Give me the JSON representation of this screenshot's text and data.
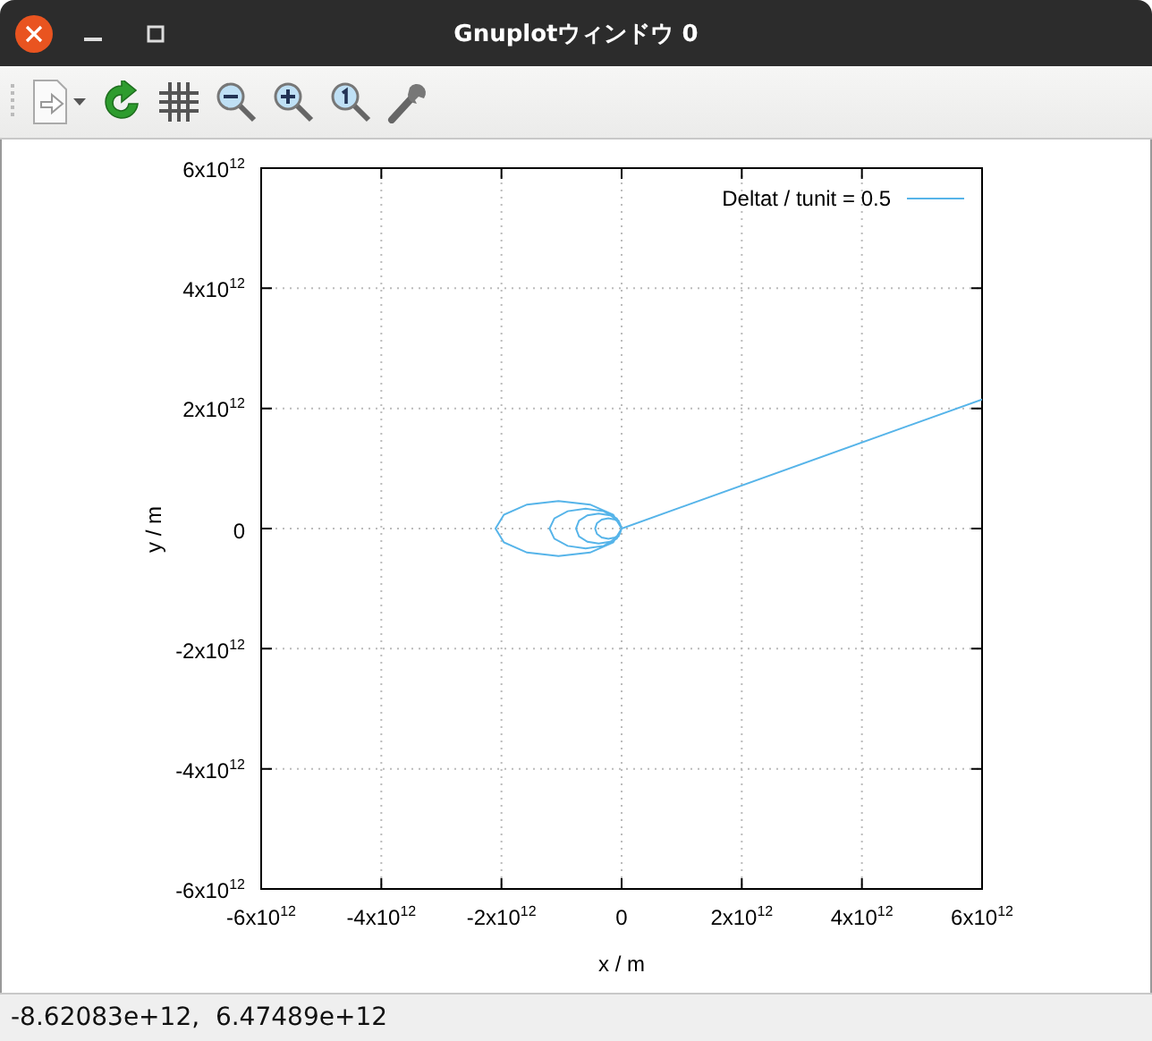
{
  "window": {
    "title": "Gnuplotウィンドウ 0"
  },
  "plot": {
    "chart_data": {
      "type": "line",
      "grid": true,
      "xlabel": "x / m",
      "ylabel": "y / m",
      "xlim": [
        -6000000000000.0,
        6000000000000.0
      ],
      "ylim": [
        -6000000000000.0,
        6000000000000.0
      ],
      "xticks": [
        {
          "value": -6000000000000.0,
          "label": "-6x10$^{12}$"
        },
        {
          "value": -4000000000000.0,
          "label": "-4x10$^{12}$"
        },
        {
          "value": -2000000000000.0,
          "label": "-2x10$^{12}$"
        },
        {
          "value": 0,
          "label": "0"
        },
        {
          "value": 2000000000000.0,
          "label": "2x10$^{12}$"
        },
        {
          "value": 4000000000000.0,
          "label": "4x10$^{12}$"
        },
        {
          "value": 6000000000000.0,
          "label": "6x10$^{12}$"
        }
      ],
      "yticks": [
        {
          "value": 6000000000000.0,
          "label": "6x10$^{12}$"
        },
        {
          "value": 4000000000000.0,
          "label": "4x10$^{12}$"
        },
        {
          "value": 2000000000000.0,
          "label": "2x10$^{12}$"
        },
        {
          "value": 0,
          "label": "0"
        },
        {
          "value": -2000000000000.0,
          "label": "-2x10$^{12}$"
        },
        {
          "value": -4000000000000.0,
          "label": "-4x10$^{12}$"
        },
        {
          "value": -6000000000000.0,
          "label": "-6x10$^{12}$"
        }
      ],
      "x": [
        0,
        -140000000000.0,
        -525000000000.0,
        -1050000000000.0,
        -1575000000000.0,
        -1960000000000.0,
        -2100000000000.0,
        -1960000000000.0,
        -1575000000000.0,
        -1050000000000.0,
        -525000000000.0,
        -140000000000.0,
        0,
        -80000000000.0,
        -300000000000.0,
        -600000000000.0,
        -900000000000.0,
        -1120000000000.0,
        -1200000000000.0,
        -1120000000000.0,
        -900000000000.0,
        -600000000000.0,
        -300000000000.0,
        -80000000000.0,
        0,
        -50000000000.0,
        -190000000000.0,
        -380000000000.0,
        -570000000000.0,
        -710000000000.0,
        -760000000000.0,
        -710000000000.0,
        -570000000000.0,
        -380000000000.0,
        -190000000000.0,
        -50000000000.0,
        0,
        -30000000000.0,
        -110000000000.0,
        -220000000000.0,
        -330000000000.0,
        -410000000000.0,
        -440000000000.0,
        -410000000000.0,
        -330000000000.0,
        -220000000000.0,
        -110000000000.0,
        -30000000000.0,
        0,
        6000000000000.0
      ],
      "series": [
        {
          "name": "Deltat / tunit = 0.5",
          "color": "#56b4e9",
          "values": [
            0,
            230000000000.0,
            400000000000.0,
            460000000000.0,
            400000000000.0,
            230000000000.0,
            0,
            -230000000000.0,
            -400000000000.0,
            -460000000000.0,
            -400000000000.0,
            -230000000000.0,
            0,
            170000000000.0,
            290000000000.0,
            330000000000.0,
            290000000000.0,
            170000000000.0,
            0,
            -170000000000.0,
            -290000000000.0,
            -330000000000.0,
            -290000000000.0,
            -170000000000.0,
            0,
            130000000000.0,
            220000000000.0,
            250000000000.0,
            220000000000.0,
            130000000000.0,
            0,
            -130000000000.0,
            -220000000000.0,
            -250000000000.0,
            -220000000000.0,
            -130000000000.0,
            0,
            90000000000.0,
            150000000000.0,
            170000000000.0,
            150000000000.0,
            90000000000.0,
            0,
            -90000000000.0,
            -150000000000.0,
            -170000000000.0,
            -150000000000.0,
            -90000000000.0,
            0,
            2150000000000.0
          ]
        }
      ]
    }
  },
  "status_bar": {
    "text": "-8.62083e+12,  6.47489e+12"
  }
}
